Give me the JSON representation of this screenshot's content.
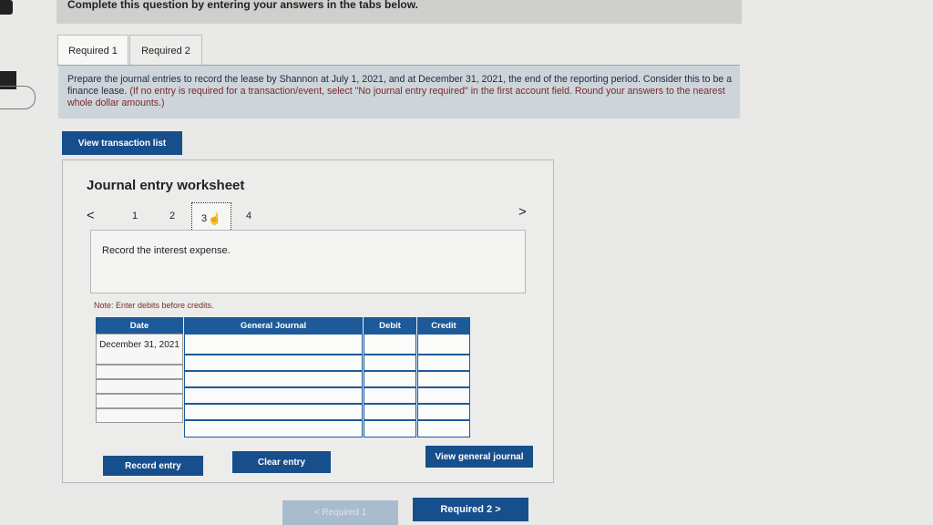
{
  "header": {
    "instruction": "Complete this question by entering your answers in the tabs below."
  },
  "tabs": [
    {
      "label": "Required 1",
      "active": true
    },
    {
      "label": "Required 2",
      "active": false
    }
  ],
  "instructions": {
    "main": "Prepare the journal entries to record the lease by Shannon at July 1, 2021, and at December 31, 2021, the end of the reporting period. Consider this to be a finance lease. ",
    "paren": "(If no entry is required for a transaction/event, select \"No journal entry required\" in the first account field. Round your answers to the nearest whole dollar amounts.)"
  },
  "buttons": {
    "view_transaction_list": "View transaction list",
    "record_entry": "Record entry",
    "clear_entry": "Clear entry",
    "view_general_journal": "View general journal"
  },
  "worksheet": {
    "title": "Journal entry worksheet",
    "pages": [
      "1",
      "2",
      "3",
      "4"
    ],
    "current_page": "3",
    "prev_symbol": "<",
    "next_symbol": ">",
    "description": "Record the interest expense.",
    "note": "Note: Enter debits before credits.",
    "columns": [
      "Date",
      "General Journal",
      "Debit",
      "Credit"
    ],
    "date_value": "December 31, 2021"
  },
  "navigation": {
    "prev_label": "< Required 1",
    "next_label": "Required 2 >"
  },
  "colors": {
    "primary": "#174e8c",
    "header_blue": "#1d5a9a"
  }
}
